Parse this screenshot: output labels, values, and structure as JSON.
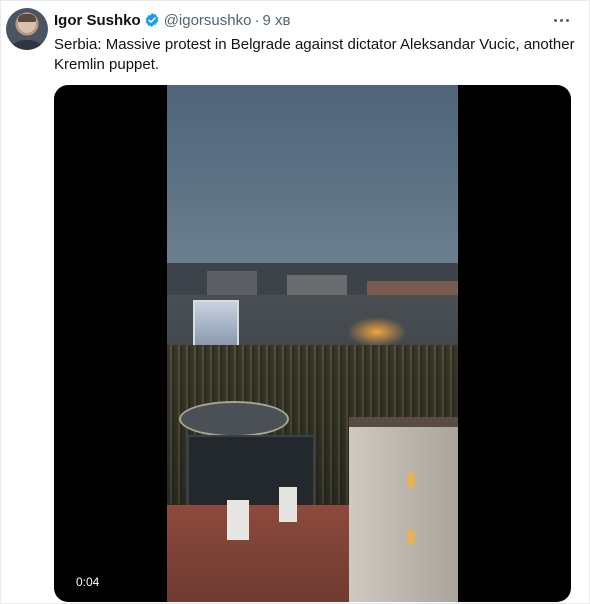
{
  "tweet": {
    "author_name": "Igor Sushko",
    "handle": "@igorsushko",
    "separator": "·",
    "time": "9 хв",
    "text": "Serbia: Massive protest in Belgrade against dictator Aleksandar Vucic, another Kremlin puppet.",
    "verified_icon": "verified-badge-icon",
    "more_icon": "more-options-icon"
  },
  "media": {
    "video_timestamp": "0:04"
  },
  "colors": {
    "accent": "#1d9bf0",
    "text_primary": "#0f1419",
    "text_secondary": "#536471"
  }
}
